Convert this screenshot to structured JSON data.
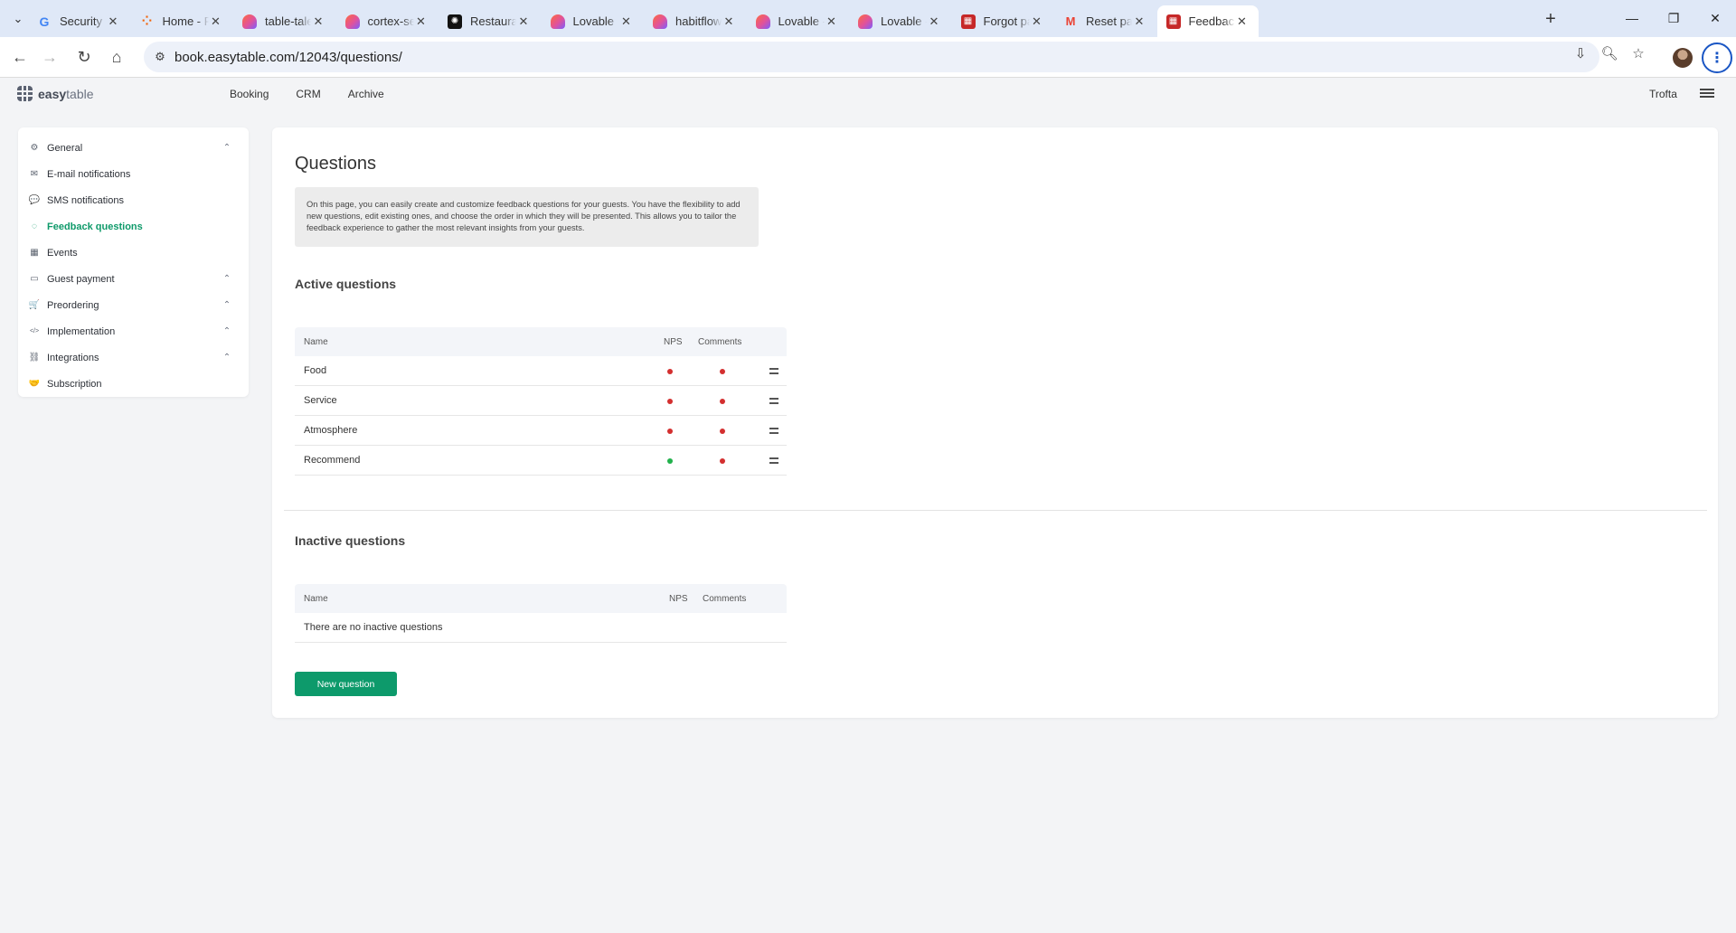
{
  "browser": {
    "tabs": [
      {
        "title": "Security Che",
        "favicon": "google-icon",
        "color": "#4285f4",
        "glyph": "G"
      },
      {
        "title": "Home - Repl",
        "favicon": "replit-icon",
        "color": "#f26207",
        "glyph": "⁘"
      },
      {
        "title": "table-tales-a",
        "favicon": "lovable-icon",
        "color": "#e0529c",
        "glyph": ""
      },
      {
        "title": "cortex-secon",
        "favicon": "lovable-icon",
        "color": "#e0529c",
        "glyph": ""
      },
      {
        "title": "Restaurant R",
        "favicon": "openai-icon",
        "color": "#111111",
        "glyph": "✺"
      },
      {
        "title": "Lovable",
        "favicon": "lovable-icon",
        "color": "#e0529c",
        "glyph": ""
      },
      {
        "title": "habitflow - L",
        "favicon": "lovable-icon",
        "color": "#e0529c",
        "glyph": ""
      },
      {
        "title": "Lovable - Bu",
        "favicon": "lovable-icon",
        "color": "#e0529c",
        "glyph": ""
      },
      {
        "title": "Lovable - Bu",
        "favicon": "lovable-icon",
        "color": "#e0529c",
        "glyph": ""
      },
      {
        "title": "Forgot pass",
        "favicon": "easytable-icon",
        "color": "#c62828",
        "glyph": "▦"
      },
      {
        "title": "Reset passw",
        "favicon": "gmail-icon",
        "color": "#ea4335",
        "glyph": "M"
      },
      {
        "title": "Feedback qu",
        "favicon": "easytable-icon",
        "color": "#c62828",
        "glyph": "▦"
      }
    ],
    "active_tab_index": 11,
    "url": "book.easytable.com/12043/questions/"
  },
  "app": {
    "logo_bold": "easy",
    "logo_light": "table",
    "nav": [
      "Booking",
      "CRM",
      "Archive"
    ],
    "account_name": "Trofta"
  },
  "sidebar": {
    "items": [
      {
        "label": "General",
        "icon": "gear-icon",
        "glyph": "⚙",
        "expandable": true,
        "active": false
      },
      {
        "label": "E-mail notifications",
        "icon": "envelope-icon",
        "glyph": "✉",
        "expandable": false,
        "active": false
      },
      {
        "label": "SMS notifications",
        "icon": "chat-icon",
        "glyph": "💬",
        "expandable": false,
        "active": false
      },
      {
        "label": "Feedback questions",
        "icon": "feedback-icon",
        "glyph": "◌",
        "expandable": false,
        "active": true
      },
      {
        "label": "Events",
        "icon": "calendar-icon",
        "glyph": "▦",
        "expandable": false,
        "active": false
      },
      {
        "label": "Guest payment",
        "icon": "credit-card-icon",
        "glyph": "▭",
        "expandable": true,
        "active": false
      },
      {
        "label": "Preordering",
        "icon": "cart-icon",
        "glyph": "🛒",
        "expandable": true,
        "active": false
      },
      {
        "label": "Implementation",
        "icon": "code-icon",
        "glyph": "</>",
        "expandable": true,
        "active": false
      },
      {
        "label": "Integrations",
        "icon": "link-icon",
        "glyph": "⛓",
        "expandable": true,
        "active": false
      },
      {
        "label": "Subscription",
        "icon": "handshake-icon",
        "glyph": "🤝",
        "expandable": false,
        "active": false
      }
    ]
  },
  "main": {
    "title": "Questions",
    "info": "On this page, you can easily create and customize feedback questions for your guests. You have the flexibility to add new questions, edit existing ones, and choose the order in which they will be presented. This allows you to tailor the feedback experience to gather the most relevant insights from your guests.",
    "active_heading": "Active questions",
    "inactive_heading": "Inactive questions",
    "columns": {
      "name": "Name",
      "nps": "NPS",
      "comments": "Comments"
    },
    "active_questions": [
      {
        "name": "Food",
        "nps": "off",
        "comments": "off"
      },
      {
        "name": "Service",
        "nps": "off",
        "comments": "off"
      },
      {
        "name": "Atmosphere",
        "nps": "off",
        "comments": "off"
      },
      {
        "name": "Recommend",
        "nps": "on",
        "comments": "off"
      }
    ],
    "empty_inactive": "There are no inactive questions",
    "new_button": "New question"
  },
  "colors": {
    "accent": "#0d9a6b",
    "status_on": "#22b14c",
    "status_off": "#d32f2f"
  }
}
